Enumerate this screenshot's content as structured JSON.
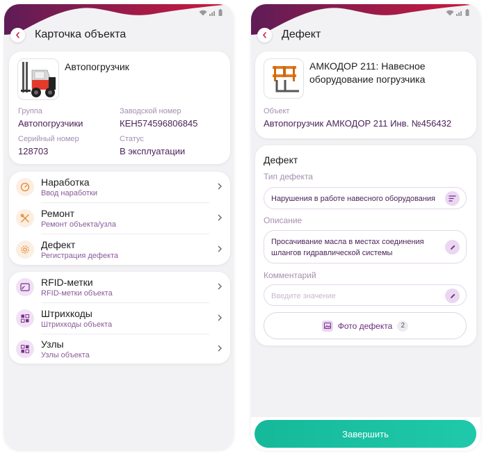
{
  "left": {
    "title": "Карточка объекта",
    "object": {
      "name": "Автопогрузчик",
      "fields": [
        {
          "label": "Группа",
          "value": "Автопогрузчики"
        },
        {
          "label": "Заводской номер",
          "value": "КЕН574596806845"
        },
        {
          "label": "Серийный номер",
          "value": "128703"
        },
        {
          "label": "Статус",
          "value": "В эксплуатации"
        }
      ]
    },
    "menu1": [
      {
        "title": "Наработка",
        "subtitle": "Ввод наработки",
        "icon": "gauge-icon"
      },
      {
        "title": "Ремонт",
        "subtitle": "Ремонт объекта/узла",
        "icon": "tools-icon"
      },
      {
        "title": "Дефект",
        "subtitle": "Регистрация дефекта",
        "icon": "gear-icon"
      }
    ],
    "menu2": [
      {
        "title": "RFID-метки",
        "subtitle": "RFID-метки объекта",
        "icon": "rfid-icon"
      },
      {
        "title": "Штрихкоды",
        "subtitle": "Штрихкоды объекта",
        "icon": "qr-icon"
      },
      {
        "title": "Узлы",
        "subtitle": "Узлы объекта",
        "icon": "nodes-icon"
      }
    ]
  },
  "right": {
    "title": "Дефект",
    "item": {
      "name": "АМКОДОР 211: Навесное оборудование погрузчика",
      "object_label": "Объект",
      "object_value": "Автопогрузчик АМКОДОР 211 Инв. №456432"
    },
    "form": {
      "section_title": "Дефект",
      "type_label": "Тип дефекта",
      "type_value": "Нарушения в работе навесного оборудования",
      "desc_label": "Описание",
      "desc_value": "Просачивание масла в местах соединения шлангов гидравлической системы",
      "comment_label": "Комментарий",
      "comment_placeholder": "Введите значение",
      "photo_label": "Фото дефекта",
      "photo_count": "2"
    },
    "finish_label": "Завершить"
  },
  "colors": {
    "accent_purple": "#6b2b7c",
    "wave_dark": "#6a1f55",
    "wave_red": "#c8183f",
    "finish_green": "#1fc9aa",
    "icon_orange": "#e58a2b"
  }
}
